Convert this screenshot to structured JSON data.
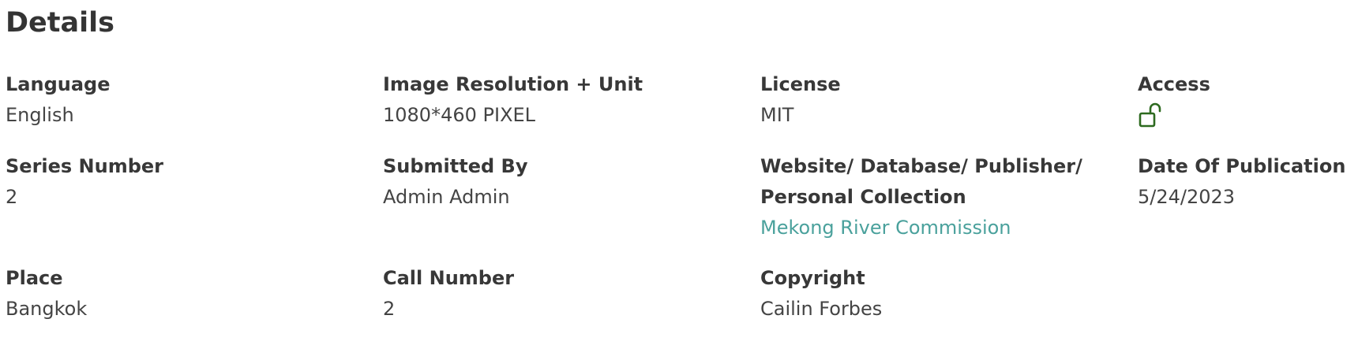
{
  "section": {
    "title": "Details"
  },
  "fields": {
    "language": {
      "label": "Language",
      "value": "English"
    },
    "resolution": {
      "label": "Image Resolution + Unit",
      "value": "1080*460 PIXEL"
    },
    "license": {
      "label": "License",
      "value": "MIT"
    },
    "access": {
      "label": "Access",
      "icon": "unlocked-padlock-icon",
      "icon_color": "#2d6a1f"
    },
    "series_number": {
      "label": "Series Number",
      "value": "2"
    },
    "submitted_by": {
      "label": "Submitted By",
      "value": "Admin Admin"
    },
    "publisher": {
      "label_line1": "Website/ Database/ Publisher/",
      "label_line2": "Personal Collection",
      "value": "Mekong River Commission",
      "link_color": "#4aa19c"
    },
    "date_of_publication": {
      "label": "Date Of Publication",
      "value": "5/24/2023"
    },
    "place": {
      "label": "Place",
      "value": "Bangkok"
    },
    "call_number": {
      "label": "Call Number",
      "value": "2"
    },
    "copyright": {
      "label": "Copyright",
      "value": "Cailin Forbes"
    }
  }
}
